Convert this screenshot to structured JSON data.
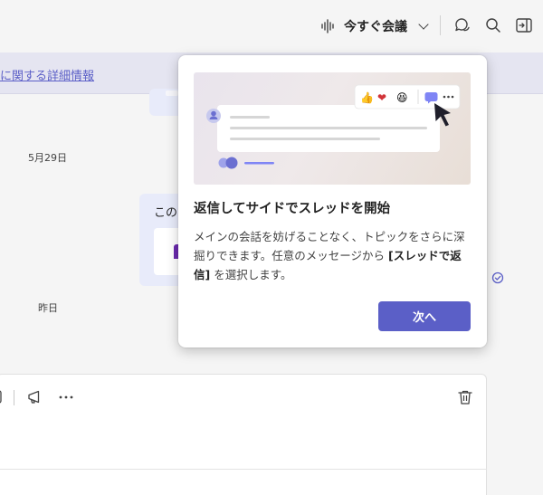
{
  "header": {
    "meet_now_label": "今すぐ会議",
    "icons": [
      "waveform-icon",
      "chevron-down-icon",
      "chat-bubbles-icon",
      "search-icon",
      "open-panel-icon"
    ]
  },
  "banner": {
    "link_text": "に関する詳細情報"
  },
  "chat": {
    "dates": [
      "5月29日",
      "昨日"
    ],
    "message_preview": "この"
  },
  "popup": {
    "title": "返信してサイドでスレッドを開始",
    "body_part1": "メインの会話を妨げることなく、トピックをさらに深掘りできます。任意のメッセージから ",
    "body_bold": "[スレッドで返信]",
    "body_part2": " を選択します。",
    "next_button": "次へ"
  },
  "colors": {
    "accent": "#5b5fc7",
    "banner_bg": "#e5e5f1",
    "bubble_bg": "#e8ebfa",
    "page_bg": "#f5f5f5"
  }
}
